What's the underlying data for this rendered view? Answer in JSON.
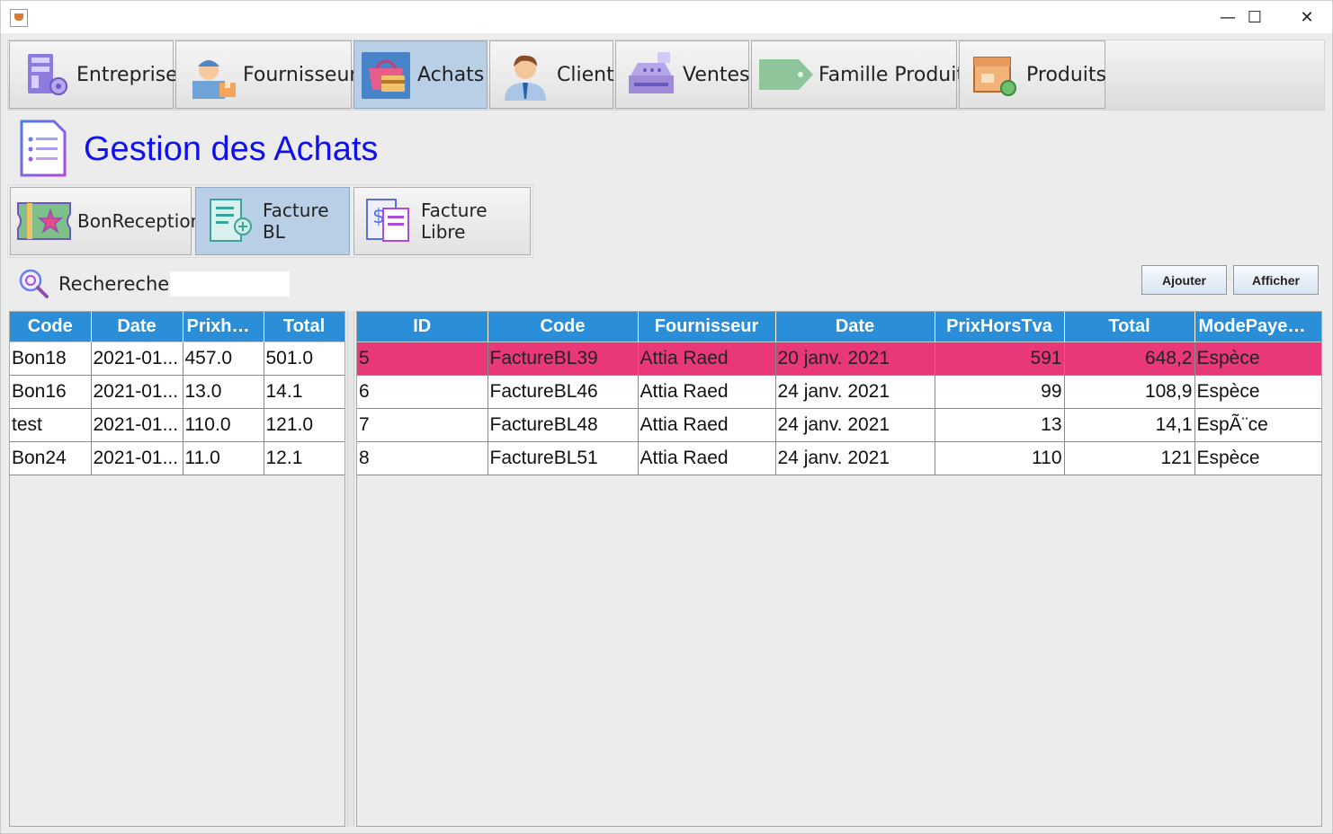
{
  "window": {
    "minimize_glyph": "—",
    "maximize_glyph": "☐",
    "close_glyph": "✕"
  },
  "nav": {
    "items": [
      {
        "label": "Entreprise",
        "icon": "building-icon"
      },
      {
        "label": "Fournisseur",
        "icon": "delivery-man-icon"
      },
      {
        "label": "Achats",
        "icon": "shopping-basket-icon",
        "selected": true
      },
      {
        "label": "Client",
        "icon": "businessman-icon"
      },
      {
        "label": "Ventes",
        "icon": "cash-register-icon"
      },
      {
        "label": "Famille Produit",
        "icon": "price-tag-icon"
      },
      {
        "label": "Produits",
        "icon": "product-box-icon"
      }
    ]
  },
  "page": {
    "title": "Gestion des Achats"
  },
  "sub_tabs": [
    {
      "label": "BonReception",
      "icon": "ticket-star-icon"
    },
    {
      "label": "Facture BL",
      "icon": "receipt-icon",
      "selected": true
    },
    {
      "label": "Facture Libre",
      "icon": "invoice-dollar-icon"
    }
  ],
  "search": {
    "label": "Rechereche",
    "value": ""
  },
  "actions": {
    "add_label": "Ajouter",
    "show_label": "Afficher"
  },
  "bons_table": {
    "columns": [
      "Code",
      "Date",
      "Prixhor...",
      "Total"
    ],
    "rows": [
      [
        "Bon18",
        "2021-01...",
        "457.0",
        "501.0"
      ],
      [
        "Bon16",
        "2021-01...",
        "13.0",
        "14.1"
      ],
      [
        "test",
        "2021-01...",
        "110.0",
        "121.0"
      ],
      [
        "Bon24",
        "2021-01...",
        "11.0",
        "12.1"
      ]
    ]
  },
  "factures_table": {
    "columns": [
      "ID",
      "Code",
      "Fournisseur",
      "Date",
      "PrixHorsTva",
      "Total",
      "ModePayem..."
    ],
    "selected_row": 0,
    "selected_color": "#e8387a",
    "rows": [
      [
        "5",
        "FactureBL39",
        "Attia Raed",
        "20 janv. 2021",
        "591",
        "648,2",
        "Espèce"
      ],
      [
        "6",
        "FactureBL46",
        "Attia Raed",
        "24 janv. 2021",
        "99",
        "108,9",
        "Espèce"
      ],
      [
        "7",
        "FactureBL48",
        "Attia Raed",
        "24 janv. 2021",
        "13",
        "14,1",
        "EspÃ¨ce"
      ],
      [
        "8",
        "FactureBL51",
        "Attia Raed",
        "24 janv. 2021",
        "110",
        "121",
        "Espèce"
      ]
    ]
  },
  "colors": {
    "header_blue": "#2a8fd8",
    "title_blue": "#1010e8",
    "selected_tab": "#b9cfe6"
  }
}
